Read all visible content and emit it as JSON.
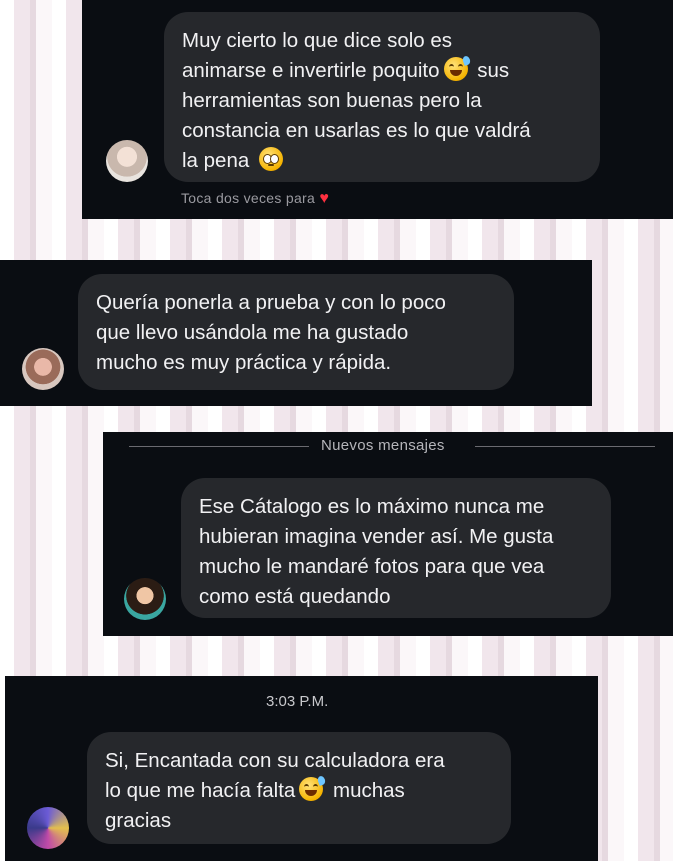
{
  "messages": [
    {
      "text_a": "Muy cierto lo que dice solo es\nanimarse e invertirle poquito",
      "text_b": " sus\nherramientas son buenas pero la\nconstancia en usarlas es lo que valdrá\nla pena ",
      "emoji_1": "grinning-sweat-emoji",
      "emoji_2": "pleading-face-emoji",
      "reaction_hint": "Toca dos veces para",
      "reaction_icon": "heart-icon"
    },
    {
      "text": "Quería ponerla a prueba y con lo poco\nque llevo usándola me ha gustado\nmucho es muy práctica y rápida."
    },
    {
      "divider": "Nuevos mensajes",
      "text": "Ese Cátalogo es lo máximo nunca me\nhubieran imagina vender así. Me gusta\nmucho le mandaré fotos para que vea\ncomo está quedando"
    },
    {
      "timestamp": "3:03 P.M.",
      "text_a": "Si, Encantada con su calculadora era\nlo que me hacía falta",
      "text_b": " muchas\ngracias",
      "emoji": "grinning-sweat-emoji"
    }
  ],
  "colors": {
    "card_background": "#0a0d12",
    "bubble_background": "#26282c",
    "heart": "#ff3040"
  }
}
